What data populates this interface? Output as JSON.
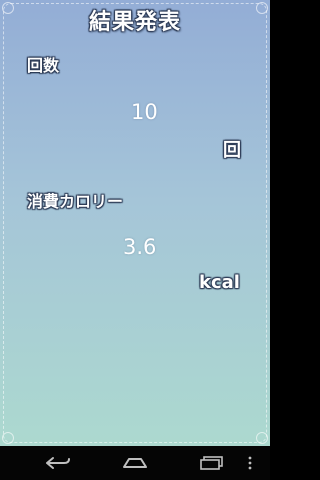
{
  "screen": {
    "title": "結果発表",
    "count_label": "回数",
    "count_value": "10",
    "count_unit": "回",
    "calorie_label": "消費カロリー",
    "calorie_value": "3.6",
    "calorie_unit": "kcal"
  },
  "navbar": {
    "back_icon": "back-icon",
    "home_icon": "home-icon",
    "recents_icon": "recents-icon",
    "menu_icon": "menu-icon"
  },
  "colors": {
    "gradient_top": "#93add6",
    "gradient_bottom": "#acd9cf",
    "navbar_bg": "#050505",
    "nav_icon": "#bfbfbf"
  }
}
